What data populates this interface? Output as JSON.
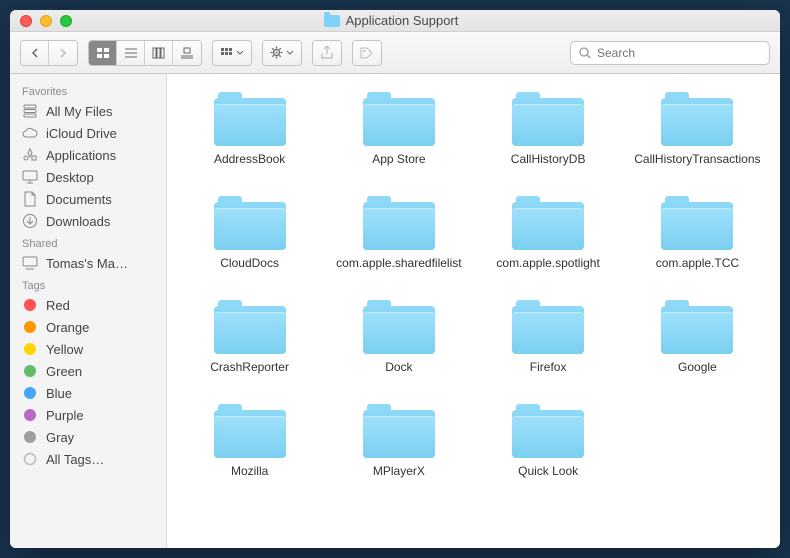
{
  "window": {
    "title": "Application Support"
  },
  "toolbar": {
    "search_placeholder": "Search"
  },
  "sidebar": {
    "sections": [
      {
        "header": "Favorites",
        "items": [
          {
            "icon": "all-my-files",
            "label": "All My Files"
          },
          {
            "icon": "icloud",
            "label": "iCloud Drive"
          },
          {
            "icon": "applications",
            "label": "Applications"
          },
          {
            "icon": "desktop",
            "label": "Desktop"
          },
          {
            "icon": "documents",
            "label": "Documents"
          },
          {
            "icon": "downloads",
            "label": "Downloads"
          }
        ]
      },
      {
        "header": "Shared",
        "items": [
          {
            "icon": "computer",
            "label": "Tomas's Ma…"
          }
        ]
      },
      {
        "header": "Tags",
        "items": [
          {
            "icon": "tag",
            "color": "#ff5252",
            "label": "Red"
          },
          {
            "icon": "tag",
            "color": "#ff9800",
            "label": "Orange"
          },
          {
            "icon": "tag",
            "color": "#ffd600",
            "label": "Yellow"
          },
          {
            "icon": "tag",
            "color": "#66bb6a",
            "label": "Green"
          },
          {
            "icon": "tag",
            "color": "#42a5f5",
            "label": "Blue"
          },
          {
            "icon": "tag",
            "color": "#ba68c8",
            "label": "Purple"
          },
          {
            "icon": "tag",
            "color": "#9e9e9e",
            "label": "Gray"
          },
          {
            "icon": "all-tags",
            "label": "All Tags…"
          }
        ]
      }
    ]
  },
  "folders": [
    {
      "name": "AddressBook"
    },
    {
      "name": "App Store"
    },
    {
      "name": "CallHistoryDB"
    },
    {
      "name": "CallHistoryTransactions"
    },
    {
      "name": "CloudDocs"
    },
    {
      "name": "com.apple.sharedfilelist"
    },
    {
      "name": "com.apple.spotlight"
    },
    {
      "name": "com.apple.TCC"
    },
    {
      "name": "CrashReporter"
    },
    {
      "name": "Dock"
    },
    {
      "name": "Firefox"
    },
    {
      "name": "Google"
    },
    {
      "name": "Mozilla"
    },
    {
      "name": "MPlayerX"
    },
    {
      "name": "Quick Look"
    }
  ]
}
